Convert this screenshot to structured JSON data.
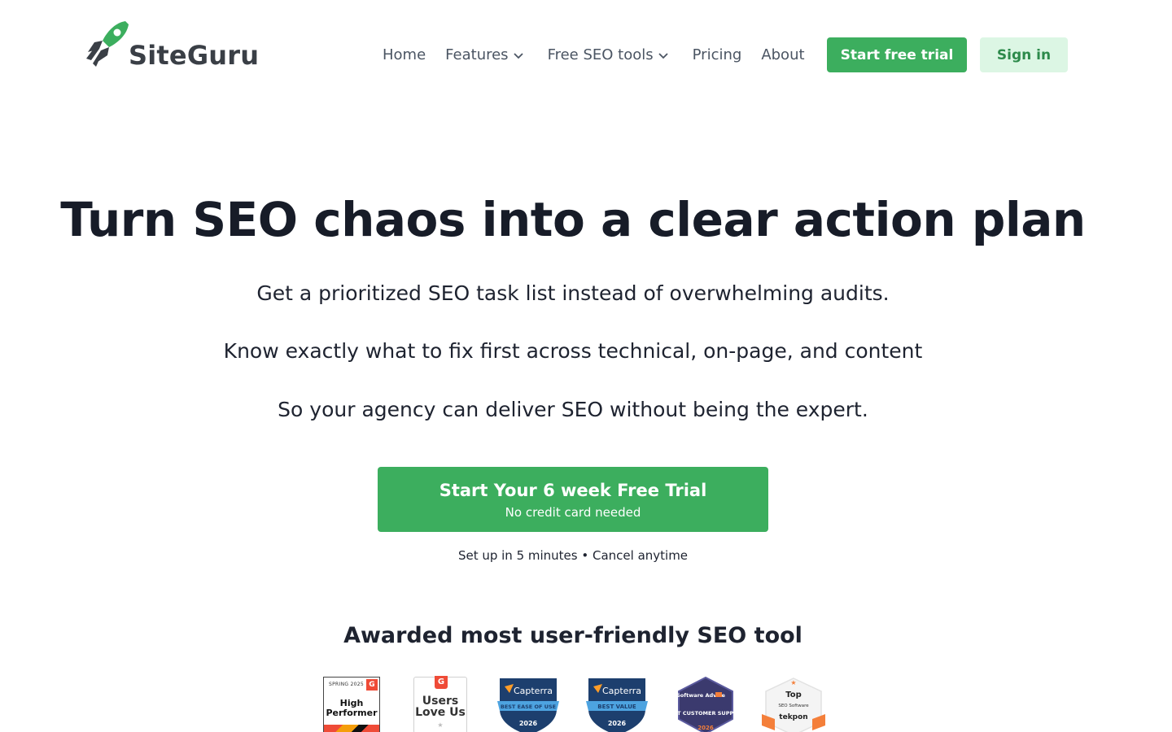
{
  "header": {
    "logo_text": "SiteGuru",
    "nav": [
      {
        "label": "Home",
        "has_dropdown": false
      },
      {
        "label": "Features",
        "has_dropdown": true
      },
      {
        "label": "Free SEO tools",
        "has_dropdown": true
      },
      {
        "label": "Pricing",
        "has_dropdown": false
      },
      {
        "label": "About",
        "has_dropdown": false
      }
    ],
    "trial_button": "Start free trial",
    "signin_button": "Sign in"
  },
  "hero": {
    "title": "Turn SEO chaos into a clear action plan",
    "lines": [
      "Get a prioritized SEO task list instead of overwhelming audits.",
      "Know exactly what to fix first across technical, on-page, and content",
      "So your agency can deliver SEO without being the expert."
    ],
    "cta_main": "Start Your 6 week Free Trial",
    "cta_sub": "No credit card needed",
    "setup_text": "Set up in 5 minutes • Cancel anytime"
  },
  "awards": {
    "heading": "Awarded most user-friendly SEO tool",
    "badges": [
      {
        "icon": "g2-high-performer-badge",
        "season": "SPRING 2025",
        "label": "High Performer"
      },
      {
        "icon": "g2-users-love-us-badge",
        "label": "Users Love Us"
      },
      {
        "icon": "capterra-best-ease-of-use-badge",
        "brand": "Capterra",
        "label": "BEST EASE OF USE",
        "year": "2026"
      },
      {
        "icon": "capterra-best-value-badge",
        "brand": "Capterra",
        "label": "BEST VALUE",
        "year": "2026"
      },
      {
        "icon": "software-advice-badge",
        "brand": "Software Advice",
        "label": "BEST CUSTOMER SUPPORT",
        "year": "2026"
      },
      {
        "icon": "tekpon-top-seo-software-badge",
        "label": "Top",
        "sub": "SEO Software",
        "brand": "tekpon"
      }
    ]
  },
  "colors": {
    "brand_green": "#3cae5e",
    "signin_bg": "#dcf6e4",
    "text_dark": "#171c28"
  }
}
